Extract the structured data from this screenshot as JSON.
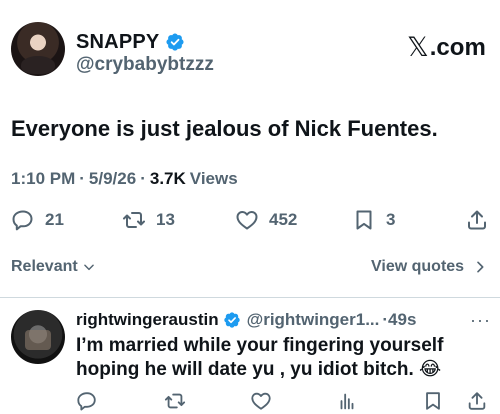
{
  "author": {
    "display_name": "SNAPPY",
    "handle": "@crybabybtzzz"
  },
  "brand": {
    "logo_text": ".com",
    "logo_glyph": "𝕏"
  },
  "tweet": {
    "text": "Everyone is just jealous of Nick Fuentes.",
    "time": "1:10 PM",
    "date": "5/9/26",
    "views_count": "3.7K",
    "views_label": "Views",
    "sep": "·"
  },
  "actions": {
    "replies": "21",
    "reposts": "13",
    "likes": "452",
    "bookmarks": "3"
  },
  "sort": {
    "relevant_label": "Relevant",
    "view_quotes_label": "View quotes"
  },
  "reply": {
    "display_name": "rightwingeraustin",
    "handle": "@rightwinger1...",
    "time": "·49s",
    "more": "···",
    "text": "I’m married while your fingering yourself hoping he will date yu , yu idiot bitch. 😂"
  },
  "colors": {
    "verified": "#1d9bf0",
    "secondary_text": "#536471",
    "divider": "#cfd9de"
  }
}
